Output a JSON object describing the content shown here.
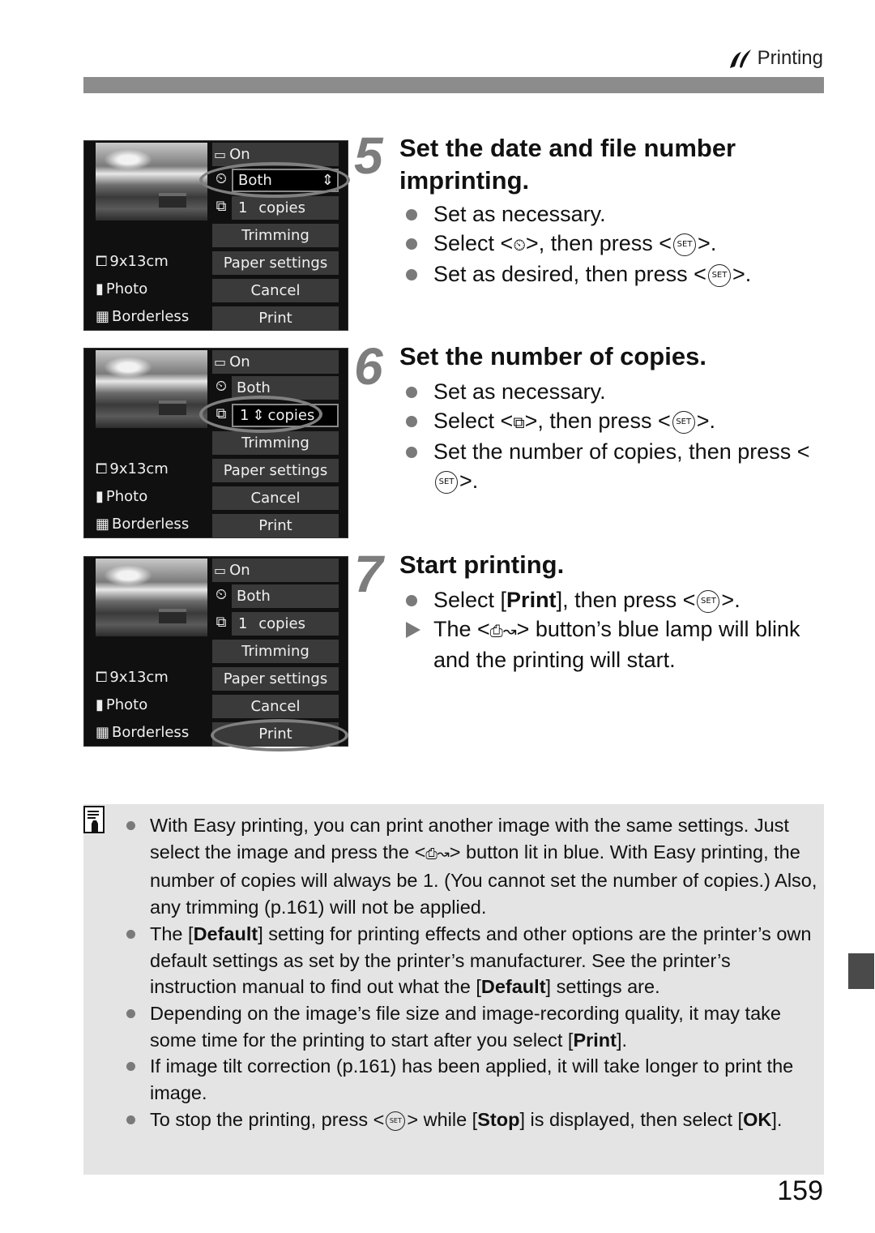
{
  "header": {
    "section_icon": "printing-icon",
    "section_title": "Printing"
  },
  "screens": [
    {
      "options": {
        "effects": "On",
        "imprint": "Both",
        "copies_num": "1",
        "copies_label": "copies",
        "trimming": "Trimming",
        "paper_settings": "Paper settings",
        "cancel": "Cancel",
        "print": "Print"
      },
      "left": {
        "paper_size": "9x13cm",
        "paper_type": "Photo",
        "layout": "Borderless"
      },
      "highlighted": "imprint"
    },
    {
      "options": {
        "effects": "On",
        "imprint": "Both",
        "copies_num": "1",
        "copies_label": "copies",
        "trimming": "Trimming",
        "paper_settings": "Paper settings",
        "cancel": "Cancel",
        "print": "Print"
      },
      "left": {
        "paper_size": "9x13cm",
        "paper_type": "Photo",
        "layout": "Borderless"
      },
      "highlighted": "copies"
    },
    {
      "options": {
        "effects": "On",
        "imprint": "Both",
        "copies_num": "1",
        "copies_label": "copies",
        "trimming": "Trimming",
        "paper_settings": "Paper settings",
        "cancel": "Cancel",
        "print": "Print"
      },
      "left": {
        "paper_size": "9x13cm",
        "paper_type": "Photo",
        "layout": "Borderless"
      },
      "highlighted": "print"
    }
  ],
  "steps": [
    {
      "number": "5",
      "title": "Set the date and file number imprinting.",
      "items": [
        {
          "pre": "Set as necessary."
        },
        {
          "pre": "Select <",
          "icon": "imprint-icon",
          "mid": ">, then press <",
          "set": "SET",
          "post": ">."
        },
        {
          "pre": "Set as desired, then press <",
          "set": "SET",
          "post": ">."
        }
      ]
    },
    {
      "number": "6",
      "title": "Set the number of copies.",
      "items": [
        {
          "pre": "Set as necessary."
        },
        {
          "pre": "Select <",
          "icon": "copies-icon",
          "mid": ">, then press <",
          "set": "SET",
          "post": ">."
        },
        {
          "pre": "Set the number of copies, then press <",
          "set": "SET",
          "post": ">."
        }
      ]
    },
    {
      "number": "7",
      "title": "Start printing.",
      "items": [
        {
          "pre": "Select [",
          "bold": "Print",
          "mid": "], then press <",
          "set": "SET",
          "post": ">."
        },
        {
          "pre": "The <",
          "icon": "print-share-icon",
          "mid": "> button’s blue lamp will blink and the printing will start.",
          "result": true
        }
      ]
    }
  ],
  "note": {
    "icon": "memo-icon",
    "items": [
      {
        "a": "With Easy printing, you can print another image with the same settings. Just select the image and press the <",
        "icon": "print-share-icon",
        "b": "> button lit in blue. With Easy printing, the number of copies will always be 1. (You cannot set the number of copies.) Also, any trimming (p.161) will not be applied."
      },
      {
        "a": "The [",
        "bold1": "Default",
        "b": "] setting for printing effects and other options are the printer’s own default settings as set by the printer’s manufacturer. See the printer’s instruction manual to find out what the [",
        "bold2": "Default",
        "c": "] settings are."
      },
      {
        "a": "Depending on the image’s file size and image-recording quality, it may take some time for the printing to start after you select [",
        "bold1": "Print",
        "b": "]."
      },
      {
        "a": "If image tilt correction (p.161) has been applied, it will take longer to print the image."
      },
      {
        "a": "To stop the printing, press <",
        "set": "SET",
        "b": "> while [",
        "bold1": "Stop",
        "c": "] is displayed, then select [",
        "bold2": "OK",
        "d": "]."
      }
    ]
  },
  "page_number": "159",
  "set_button_label": "SET",
  "glyphs": {
    "imprint": "⏲",
    "copies": "⧉",
    "print_share": "⎙↝",
    "updown": "⇕"
  }
}
